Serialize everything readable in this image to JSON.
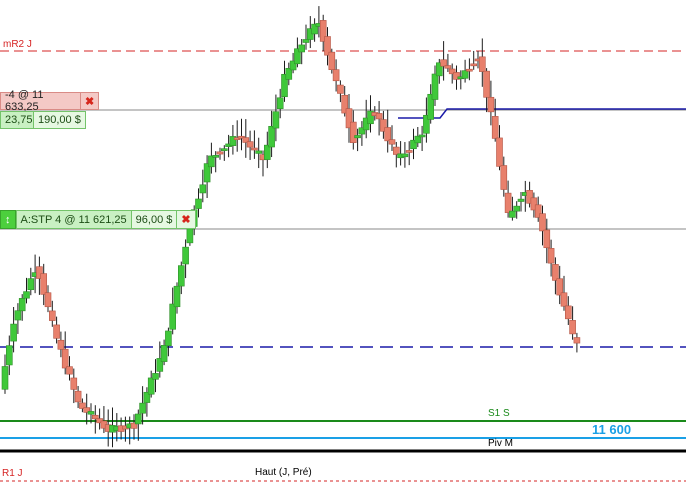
{
  "chart": {
    "levels": {
      "mr2": {
        "label": "mR2 J",
        "color": "#d62424"
      },
      "s1": {
        "label": "S1 S",
        "color": "#1a8a1a"
      },
      "pivot": {
        "label": "Piv M",
        "color": "#1aa0e6"
      },
      "r1": {
        "label": "R1 J",
        "color": "#d62424"
      },
      "high": {
        "label": "Haut (J, Pré)",
        "color": "#000000"
      },
      "pending_order_line": {
        "color": "#1a1aa8"
      },
      "round_number": {
        "label": "11 600",
        "color": "#1aa0e6"
      }
    },
    "orders": {
      "sell_order": {
        "label": "-4 @ 11 633,25",
        "close": "✖"
      },
      "sell_pnl": {
        "points": "23,75",
        "amount": "190,00 $"
      },
      "stop_order": {
        "arrow": "↕",
        "label": "A:STP  4 @ 11 621,25",
        "amount": "96,00 $",
        "close": "✖"
      }
    },
    "colors": {
      "up": "#3fc83a",
      "down": "#e8806c",
      "wick": "#1c1c1c"
    }
  }
}
